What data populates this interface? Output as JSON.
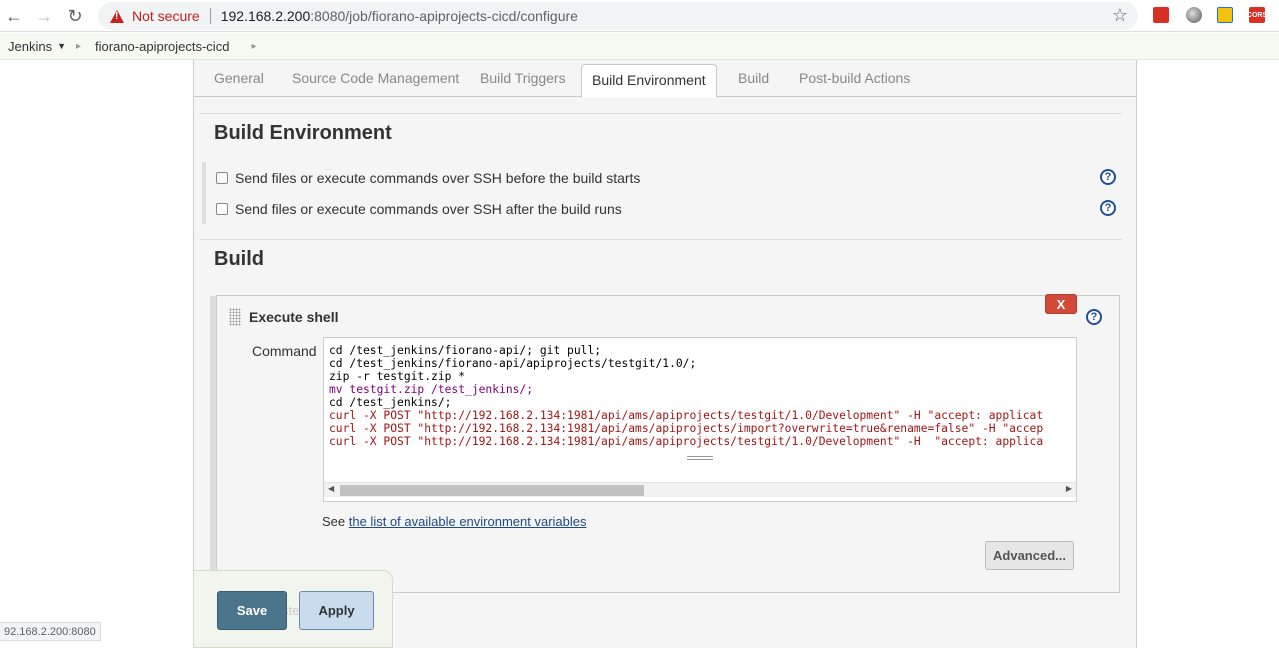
{
  "browser": {
    "not_secure_label": "Not secure",
    "url_host": "192.168.2.200",
    "url_rest": ":8080/job/fiorano-apiprojects-cicd/configure",
    "extension_cors_label": "CORS",
    "status_url": "92.168.2.200:8080"
  },
  "breadcrumb": {
    "items": [
      "Jenkins",
      "fiorano-apiprojects-cicd"
    ]
  },
  "tabs": [
    {
      "label": "General"
    },
    {
      "label": "Source Code Management"
    },
    {
      "label": "Build Triggers"
    },
    {
      "label": "Build Environment",
      "active": true
    },
    {
      "label": "Build"
    },
    {
      "label": "Post-build Actions"
    }
  ],
  "build_environment": {
    "title": "Build Environment",
    "options": [
      {
        "label": "Send files or execute commands over SSH before the build starts",
        "checked": false
      },
      {
        "label": "Send files or execute commands over SSH after the build runs",
        "checked": false
      }
    ]
  },
  "build": {
    "title": "Build",
    "step": {
      "title": "Execute shell",
      "delete_label": "X",
      "command_label": "Command",
      "command_lines": [
        "cd /test_jenkins/fiorano-api/; git pull;",
        "cd /test_jenkins/fiorano-api/apiprojects/testgit/1.0/;",
        "zip -r testgit.zip *",
        "mv testgit.zip /test_jenkins/;",
        "cd /test_jenkins/;",
        "curl -X POST \"http://192.168.2.134:1981/api/ams/apiprojects/testgit/1.0/Development\" -H \"accept: applicat",
        "curl -X POST \"http://192.168.2.134:1981/api/ams/apiprojects/import?overwrite=true&rename=false\" -H \"accep",
        "curl -X POST \"http://192.168.2.134:1981/api/ams/apiprojects/testgit/1.0/Development\" -H  \"accept: applica"
      ],
      "env_prefix": "See ",
      "env_link": "the list of available environment variables",
      "advanced_label": "Advanced..."
    }
  },
  "footer": {
    "save_label": "Save",
    "apply_label": "Apply",
    "hidden_text": "ste"
  },
  "colors": {
    "save_bg": "#4b758b",
    "apply_bg": "#c9dcee",
    "delete_bg": "#d24939",
    "help_blue": "#1f4e9a"
  }
}
